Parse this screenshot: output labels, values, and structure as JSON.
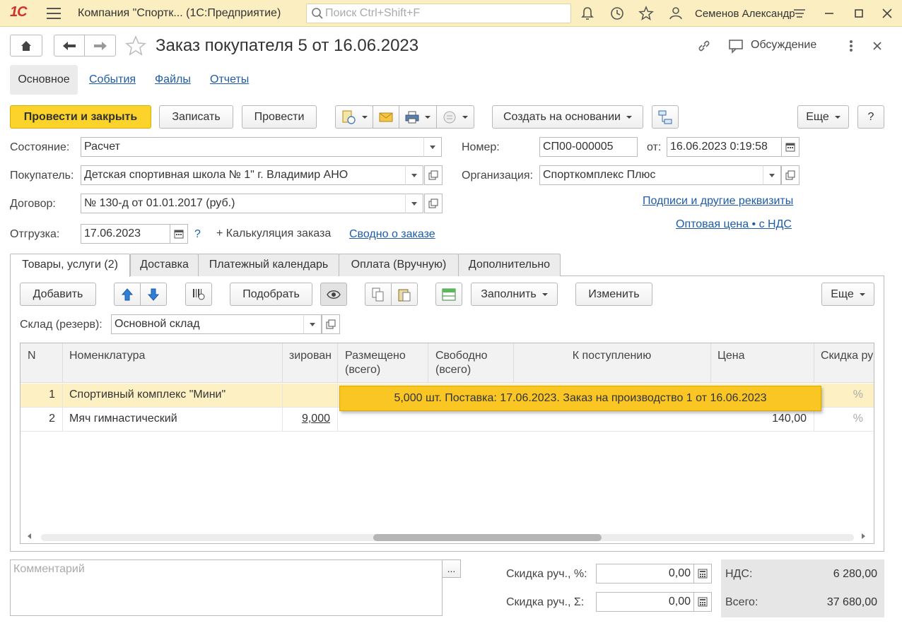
{
  "topbar": {
    "app_title": "Компания \"Спортк...   (1С:Предприятие)",
    "search_placeholder": "Поиск Ctrl+Shift+F",
    "user": "Семенов Александр"
  },
  "header": {
    "title": "Заказ покупателя 5 от 16.06.2023",
    "discussion": "Обсуждение"
  },
  "tabs": [
    "Основное",
    "События",
    "Файлы",
    "Отчеты"
  ],
  "toolbar": {
    "post_close": "Провести и закрыть",
    "save": "Записать",
    "post": "Провести",
    "create_based": "Создать на основании",
    "more": "Еще",
    "help": "?"
  },
  "form": {
    "state_label": "Состояние:",
    "state": "Расчет",
    "number_label": "Номер:",
    "number": "СП00-000005",
    "date_label": "от:",
    "date": "16.06.2023  0:19:58",
    "buyer_label": "Покупатель:",
    "buyer": "Детская спортивная школа  № 1\" г. Владимир АНО",
    "org_label": "Организация:",
    "org": "Спорткомплекс Плюс",
    "contract_label": "Договор:",
    "contract": "№ 130-д от 01.01.2017 (руб.)",
    "signatures_link": "Подписи и другие реквизиты",
    "price_link": "Оптовая цена • с НДС",
    "shipment_label": "Отгрузка:",
    "shipment": "17.06.2023",
    "shipment_help": "?",
    "calc_link": "+ Калькуляция заказа",
    "summary_link": "Сводно о заказе"
  },
  "inner_tabs": [
    "Товары, услуги (2)",
    "Доставка",
    "Платежный календарь",
    "Оплата (Вручную)",
    "Дополнительно"
  ],
  "table_toolbar": {
    "add": "Добавить",
    "pick": "Подобрать",
    "fill": "Заполнить",
    "change": "Изменить",
    "more": "Еще"
  },
  "warehouse": {
    "label": "Склад (резерв):",
    "value": "Основной склад"
  },
  "table": {
    "headers": {
      "n": "N",
      "item": "Номенклатура",
      "reserved": "зирован",
      "placed": "Размещено (всего)",
      "free": "Свободно (всего)",
      "incoming": "К поступлению",
      "price": "Цена",
      "discount": "Скидка ру"
    },
    "rows": [
      {
        "n": "1",
        "item": "Спортивный комплекс \"Мини\"",
        "reserved": "",
        "price": "",
        "discount": "%"
      },
      {
        "n": "2",
        "item": "Мяч гимнастический",
        "reserved": "9,000",
        "price": "140,00",
        "discount": "%"
      }
    ],
    "tooltip": "5,000 шт. Поставка: 17.06.2023. Заказ на производство 1 от 16.06.2023"
  },
  "footer": {
    "comment_placeholder": "Комментарий",
    "discount_pct_label": "Скидка руч., %:",
    "discount_pct": "0,00",
    "discount_sum_label": "Скидка руч., Σ:",
    "discount_sum": "0,00",
    "vat_label": "НДС:",
    "vat": "6 280,00",
    "total_label": "Всего:",
    "total": "37 680,00"
  }
}
